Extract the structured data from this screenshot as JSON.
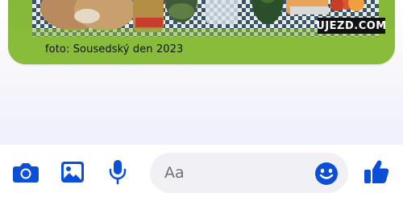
{
  "photo": {
    "caption": "foto: Sousedský den 2023",
    "watermark": "UJEZD.COM"
  },
  "composer": {
    "placeholder": "Aa"
  },
  "toolbar": {
    "icons": [
      "camera-icon",
      "image-icon",
      "microphone-icon",
      "emoji-icon",
      "thumbs-up-icon"
    ]
  },
  "colors": {
    "accent": "#0a4fd6",
    "input_bg": "#f1f1f5"
  }
}
